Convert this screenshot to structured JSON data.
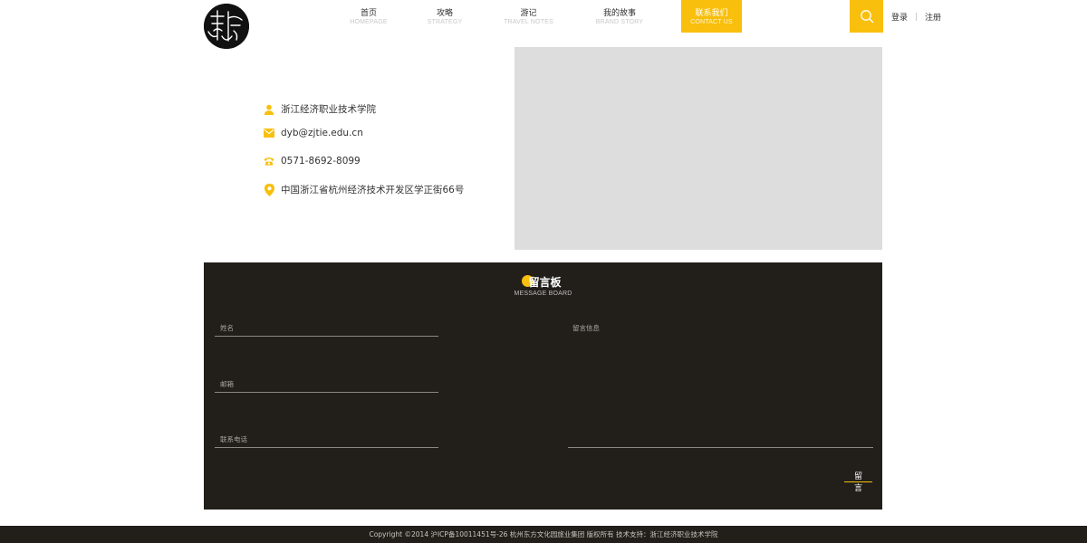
{
  "header": {
    "nav": [
      {
        "cn": "首页",
        "en": "HOMEPAGE",
        "active": false
      },
      {
        "cn": "攻略",
        "en": "STRATEGY",
        "active": false
      },
      {
        "cn": "游记",
        "en": "TRAVEL NOTES",
        "active": false
      },
      {
        "cn": "我的故事",
        "en": "BRAND STORY",
        "active": false
      },
      {
        "cn": "联系我们",
        "en": "CONTACT US",
        "active": true
      }
    ],
    "search_icon": "search-icon",
    "login_label": "登录",
    "register_label": "注册"
  },
  "contact": {
    "name": "浙江经济职业技术学院",
    "email": "dyb@zjtie.edu.cn",
    "phone": "0571-8692-8099",
    "address": "中国浙江省杭州经济技术开发区学正街66号",
    "icons": [
      "user-icon",
      "mail-icon",
      "phone-icon",
      "location-pin-icon"
    ],
    "accent_color": "#f8bf0c"
  },
  "board": {
    "title_cn": "留言板",
    "title_en": "MESSAGE BOARD",
    "name_placeholder": "姓名",
    "email_placeholder": "邮箱",
    "phone_placeholder": "联系电话",
    "message_placeholder": "留言信息",
    "submit_label": "留言",
    "background_color": "#221f1b"
  },
  "footer": {
    "text": "Copyright ©2014 沪ICP备10011451号-26 杭州东方文化园旅业集团 版权所有 技术支持：浙江经济职业技术学院"
  }
}
